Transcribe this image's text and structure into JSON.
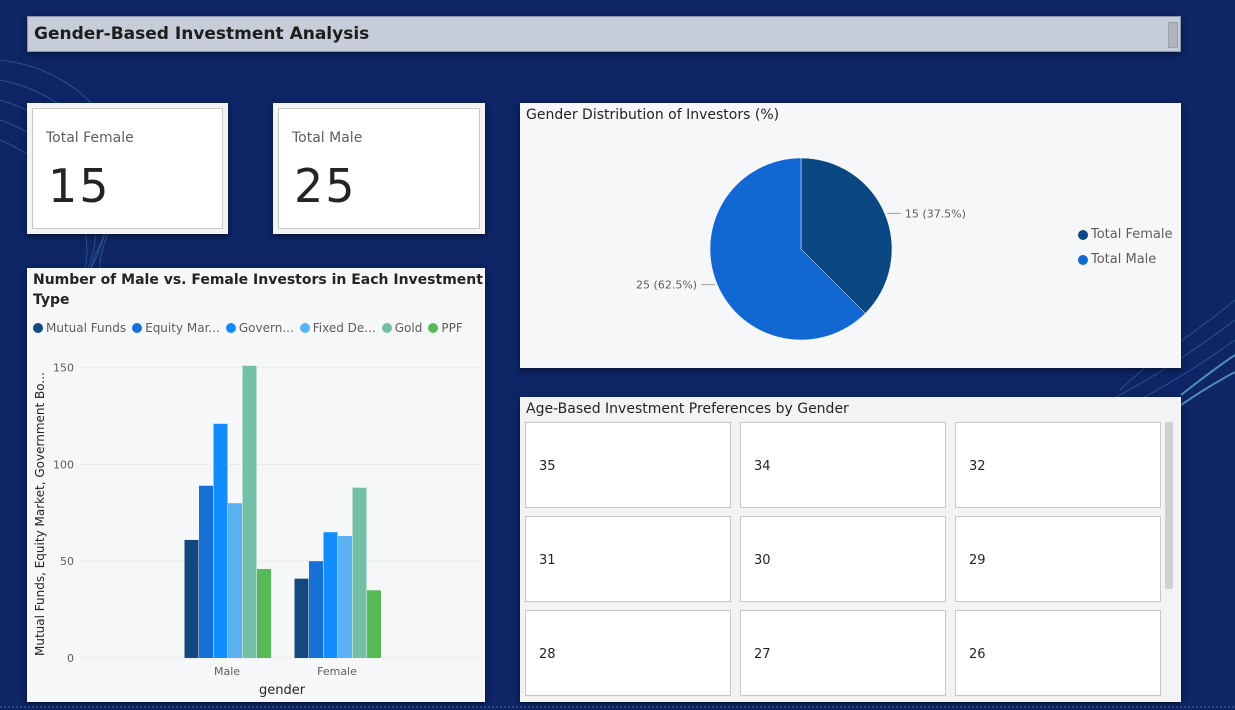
{
  "header": {
    "title": "Gender-Based Investment Analysis"
  },
  "cards": {
    "female": {
      "label": "Total Female",
      "value": "15"
    },
    "male": {
      "label": "Total Male",
      "value": "25"
    }
  },
  "colors": {
    "mutual_funds": "#12497f",
    "equity_market": "#1670d6",
    "government_bonds": "#118dff",
    "fixed_deposits": "#5ab2f5",
    "gold": "#73c0a6",
    "ppf": "#57b957",
    "female_slice": "#0b4783",
    "male_slice": "#1168d3"
  },
  "bar_panel": {
    "title_line1": "Number of Male vs. Female Investors in Each Investment",
    "title_line2": "Type",
    "legend": [
      "Mutual Funds",
      "Equity Mar...",
      "Govern...",
      "Fixed De...",
      "Gold",
      "PPF"
    ]
  },
  "pie_panel": {
    "title": "Gender Distribution of Investors (%)",
    "legend": [
      "Total Female",
      "Total Male"
    ]
  },
  "age_panel": {
    "title": "Age-Based Investment Preferences by Gender",
    "tiles": [
      "35",
      "34",
      "32",
      "31",
      "30",
      "29",
      "28",
      "27",
      "26"
    ]
  },
  "chart_data": [
    {
      "type": "bar",
      "title": "Number of Male vs. Female Investors in Each Investment Type",
      "xlabel": "gender",
      "ylabel": "Mutual Funds, Equity Market, Government Bo...",
      "categories": [
        "Male",
        "Female"
      ],
      "ylim": [
        0,
        155
      ],
      "yticks": [
        0,
        50,
        100,
        150
      ],
      "grid": true,
      "legend_position": "top",
      "series": [
        {
          "name": "Mutual Funds",
          "values": [
            61,
            41
          ]
        },
        {
          "name": "Equity Mar...",
          "values": [
            89,
            50
          ]
        },
        {
          "name": "Govern...",
          "values": [
            121,
            65
          ]
        },
        {
          "name": "Fixed De...",
          "values": [
            80,
            63
          ]
        },
        {
          "name": "Gold",
          "values": [
            151,
            88
          ]
        },
        {
          "name": "PPF",
          "values": [
            46,
            35
          ]
        }
      ]
    },
    {
      "type": "pie",
      "title": "Gender Distribution of Investors (%)",
      "categories": [
        "Total Female",
        "Total Male"
      ],
      "values": [
        15,
        25
      ],
      "data_labels": [
        "15 (37.5%)",
        "25 (62.5%)"
      ],
      "legend_position": "right"
    }
  ]
}
